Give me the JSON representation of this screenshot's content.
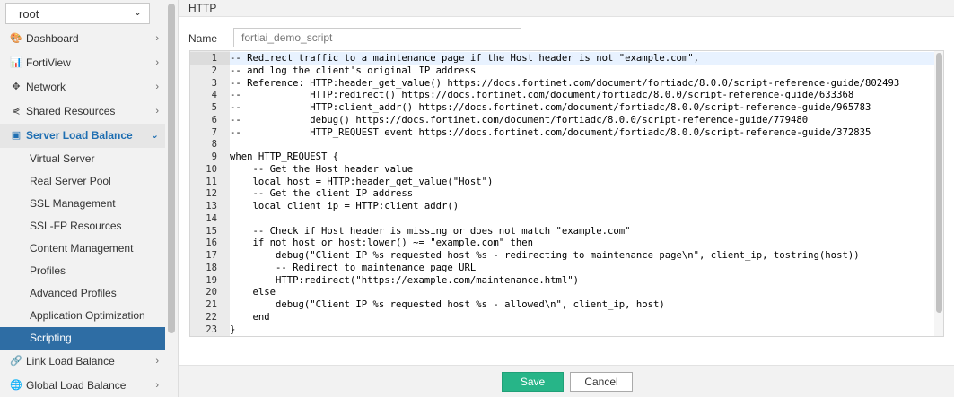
{
  "sidebar": {
    "vdom": {
      "value": "root"
    },
    "items": [
      {
        "name": "nav-dashboard",
        "label": "Dashboard",
        "icon": "palette-icon",
        "glyph": "🎨"
      },
      {
        "name": "nav-fortiview",
        "label": "FortiView",
        "icon": "bar-chart-icon",
        "glyph": "📊"
      },
      {
        "name": "nav-network",
        "label": "Network",
        "icon": "arrows-icon",
        "glyph": "✥"
      },
      {
        "name": "nav-shared-resources",
        "label": "Shared Resources",
        "icon": "share-icon",
        "glyph": "⋞"
      },
      {
        "name": "nav-server-load-balance",
        "label": "Server Load Balance",
        "icon": "server-lb-icon",
        "glyph": "▣"
      }
    ],
    "sub_items": [
      "Virtual Server",
      "Real Server Pool",
      "SSL Management",
      "SSL-FP Resources",
      "Content Management",
      "Profiles",
      "Advanced Profiles",
      "Application Optimization",
      "Scripting"
    ],
    "bottom_items": [
      {
        "name": "nav-link-load-balance",
        "label": "Link Load Balance",
        "icon": "link-icon",
        "glyph": "🔗"
      },
      {
        "name": "nav-global-load-balance",
        "label": "Global Load Balance",
        "icon": "globe-icon",
        "glyph": "🌐"
      }
    ]
  },
  "main": {
    "title": "HTTP",
    "name_label": "Name",
    "name_value": "fortiai_demo_script",
    "code_lines": [
      "-- Redirect traffic to a maintenance page if the Host header is not \"example.com\",",
      "-- and log the client's original IP address",
      "-- Reference: HTTP:header_get_value() https://docs.fortinet.com/document/fortiadc/8.0.0/script-reference-guide/802493",
      "--            HTTP:redirect() https://docs.fortinet.com/document/fortiadc/8.0.0/script-reference-guide/633368",
      "--            HTTP:client_addr() https://docs.fortinet.com/document/fortiadc/8.0.0/script-reference-guide/965783",
      "--            debug() https://docs.fortinet.com/document/fortiadc/8.0.0/script-reference-guide/779480",
      "--            HTTP_REQUEST event https://docs.fortinet.com/document/fortiadc/8.0.0/script-reference-guide/372835",
      "",
      "when HTTP_REQUEST {",
      "    -- Get the Host header value",
      "    local host = HTTP:header_get_value(\"Host\")",
      "    -- Get the client IP address",
      "    local client_ip = HTTP:client_addr()",
      "",
      "    -- Check if Host header is missing or does not match \"example.com\"",
      "    if not host or host:lower() ~= \"example.com\" then",
      "        debug(\"Client IP %s requested host %s - redirecting to maintenance page\\n\", client_ip, tostring(host))",
      "        -- Redirect to maintenance page URL",
      "        HTTP:redirect(\"https://example.com/maintenance.html\")",
      "    else",
      "        debug(\"Client IP %s requested host %s - allowed\\n\", client_ip, host)",
      "    end",
      "}"
    ],
    "save_label": "Save",
    "cancel_label": "Cancel"
  },
  "colors": {
    "active_nav": "#2e6da4",
    "open_nav_text": "#1f6fb2",
    "save_button": "#27b588"
  }
}
